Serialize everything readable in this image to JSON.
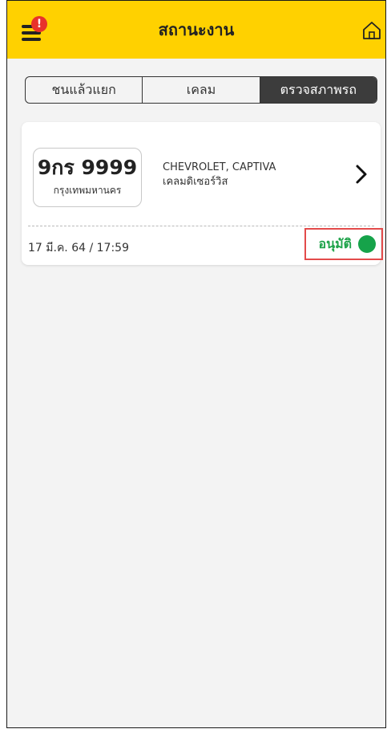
{
  "header": {
    "title": "สถานะงาน",
    "notification_badge": "!",
    "accent_color": "#ffd100"
  },
  "tabs": [
    {
      "label": "ชนแล้วแยก",
      "active": false
    },
    {
      "label": "เคลม",
      "active": false
    },
    {
      "label": "ตรวจสภาพรถ",
      "active": true
    }
  ],
  "jobs": [
    {
      "plate_number": "9กร 9999",
      "plate_province": "กรุงเทพมหานคร",
      "vehicle": "CHEVROLET, CAPTIVA",
      "service": "เคลมดิเซอร์วิส",
      "datetime": "17 มี.ค. 64 / 17:59",
      "status": "อนุมัติ",
      "status_color": "#16a34a"
    }
  ],
  "icons": {
    "menu": "hamburger-menu-icon",
    "home": "home-icon",
    "chevron": "chevron-right-icon",
    "status": "status-dot-icon"
  }
}
